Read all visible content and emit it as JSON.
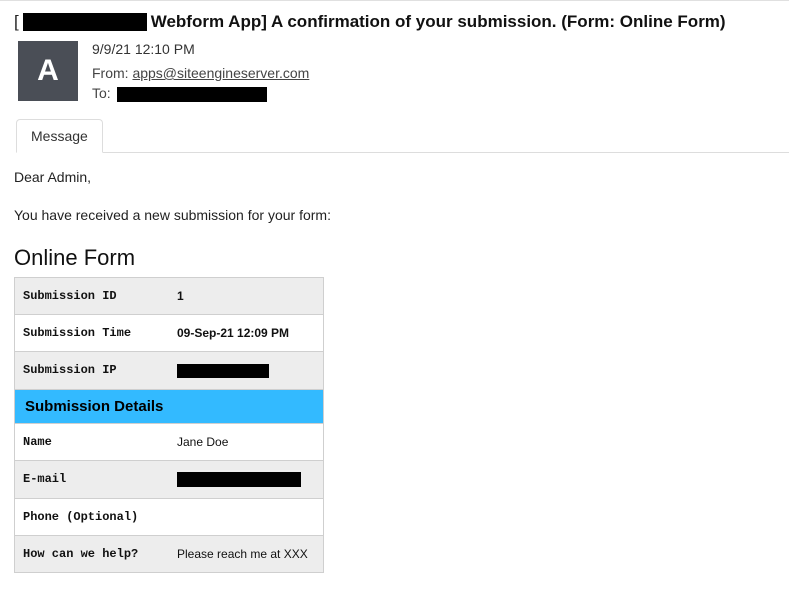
{
  "subject": {
    "bracket_open": "[",
    "text": "Webform App] A confirmation of your submission. (Form: Online Form)"
  },
  "avatar_initial": "A",
  "meta": {
    "datetime": "9/9/21 12:10 PM",
    "from_label": "From:",
    "from_value": "apps@siteengineserver.com",
    "to_label": "To:"
  },
  "tab_message": "Message",
  "greeting": "Dear Admin,",
  "intro": "You have received a new submission for your form:",
  "form_title": "Online Form",
  "rows": {
    "sub_id_label": "Submission ID",
    "sub_id_value": "1",
    "sub_time_label": "Submission Time",
    "sub_time_value": "09-Sep-21 12:09 PM",
    "sub_ip_label": "Submission IP",
    "details_header": "Submission Details",
    "name_label": "Name",
    "name_value": "Jane Doe",
    "email_label": "E-mail",
    "phone_label": "Phone (Optional)",
    "phone_value": "",
    "help_label": "How can we help?",
    "help_value": "Please reach me at XXX"
  }
}
